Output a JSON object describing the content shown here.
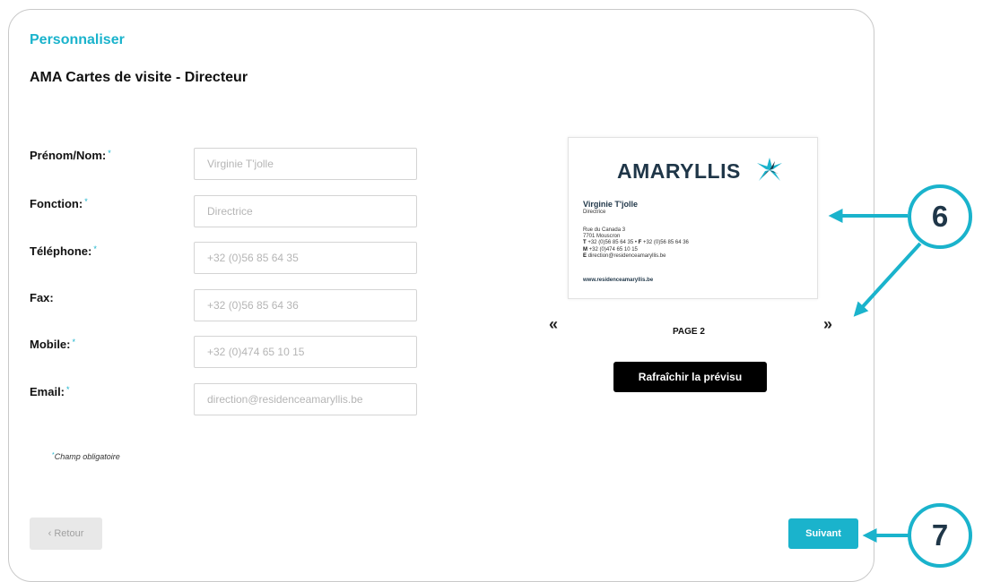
{
  "header": {
    "step_title": "Personnaliser",
    "product_title": "AMA Cartes de visite - Directeur"
  },
  "form": {
    "required_marker": "*",
    "fields": [
      {
        "label": "Prénom/Nom:",
        "required": true,
        "placeholder": "Virginie T'jolle"
      },
      {
        "label": "Fonction:",
        "required": true,
        "placeholder": "Directrice"
      },
      {
        "label": "Téléphone:",
        "required": true,
        "placeholder": "+32 (0)56 85 64 35"
      },
      {
        "label": "Fax:",
        "required": false,
        "placeholder": "+32 (0)56 85 64 36"
      },
      {
        "label": "Mobile:",
        "required": true,
        "placeholder": "+32 (0)474 65 10 15"
      },
      {
        "label": "Email:",
        "required": true,
        "placeholder": "direction@residenceamaryllis.be"
      }
    ],
    "required_note": "Champ obligatoire"
  },
  "preview": {
    "brand": "AMARYLLIS",
    "name": "Virginie T'jolle",
    "role": "Directrice",
    "address_line1": "Rue du Canada 3",
    "address_line2": "7701 Mouscron",
    "tel_prefix": "T",
    "tel": "+32 (0)56 85 64 35 •",
    "fax_prefix": "F",
    "fax": "+32 (0)56 85 64 36",
    "mobile_prefix": "M",
    "mobile": "+32 (0)474 65 10 15",
    "email_prefix": "E",
    "email": "direction@residenceamaryllis.be",
    "website": "www.residenceamaryllis.be",
    "brand_color": "#1f3648",
    "logo_color": "#1ab3cc"
  },
  "pager": {
    "prev": "«",
    "next": "»",
    "page_label": "PAGE 2"
  },
  "actions": {
    "refresh": "Rafraîchir la prévisu",
    "back": "‹ Retour",
    "next": "Suivant"
  },
  "callouts": {
    "six": "6",
    "seven": "7",
    "color": "#1ab3cc"
  }
}
